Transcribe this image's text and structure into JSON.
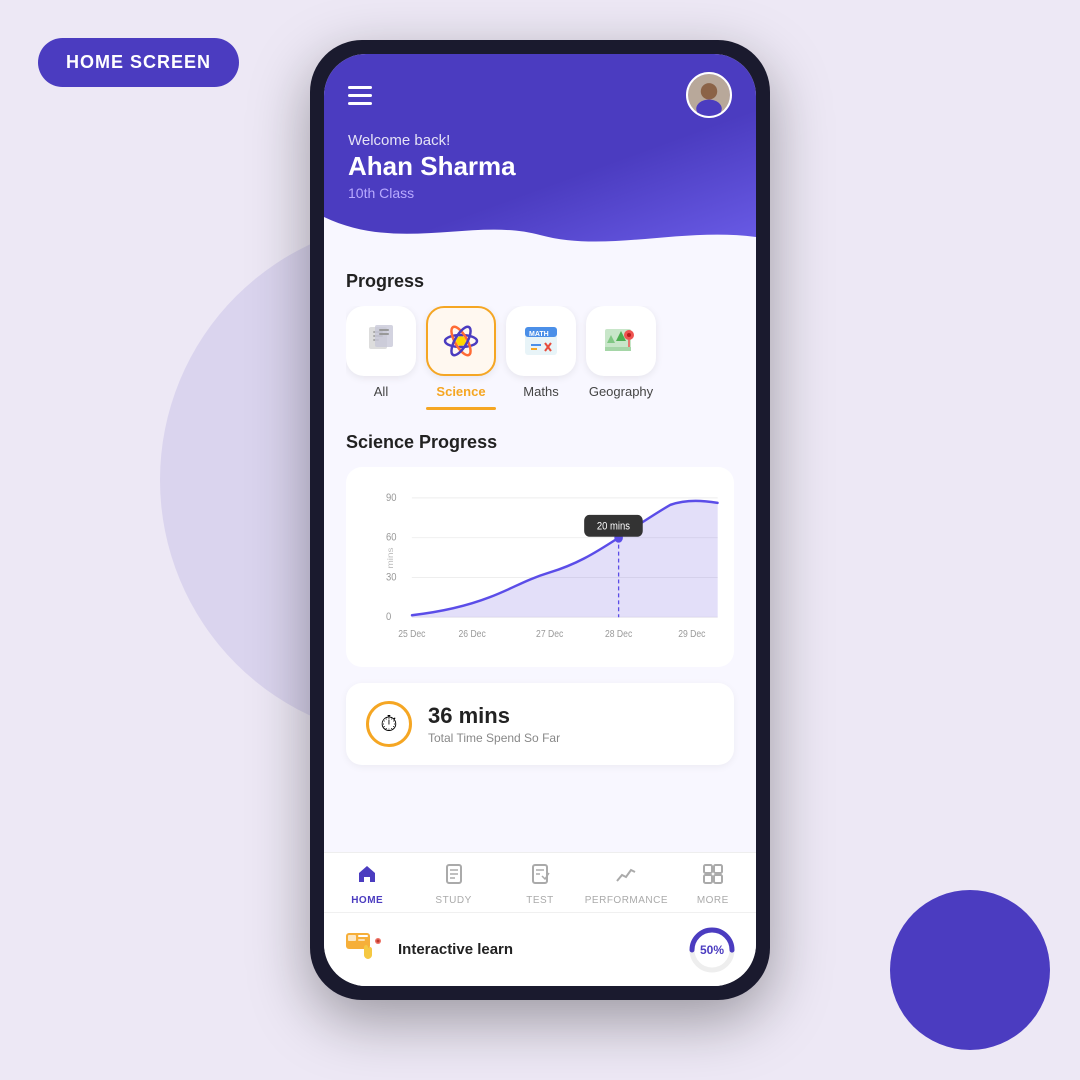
{
  "label": {
    "home_screen": "HOME SCREEN"
  },
  "header": {
    "welcome": "Welcome back!",
    "user_name": "Ahan Sharma",
    "user_class": "10th Class"
  },
  "progress_section": {
    "title": "Progress",
    "tabs": [
      {
        "id": "all",
        "label": "All",
        "icon": "📄",
        "active": false
      },
      {
        "id": "science",
        "label": "Science",
        "icon": "⚛️",
        "active": true
      },
      {
        "id": "maths",
        "label": "Maths",
        "icon": "📐",
        "active": false
      },
      {
        "id": "geography",
        "label": "Geography",
        "icon": "🗺️",
        "active": false
      }
    ]
  },
  "chart": {
    "title": "Science Progress",
    "y_label": "mins",
    "y_values": [
      "90",
      "60",
      "30",
      "0"
    ],
    "x_values": [
      "25 Dec",
      "26 Dec",
      "27 Dec",
      "28 Dec",
      "29 Dec"
    ],
    "tooltip": "20 mins",
    "tooltip_x": "28 Dec"
  },
  "stats": {
    "time": "36 mins",
    "label": "Total Time Spend So Far"
  },
  "nav": {
    "items": [
      {
        "id": "home",
        "label": "HOME",
        "icon": "🏠",
        "active": true
      },
      {
        "id": "study",
        "label": "STUDY",
        "icon": "📄",
        "active": false
      },
      {
        "id": "test",
        "label": "TEST",
        "icon": "📋",
        "active": false
      },
      {
        "id": "performance",
        "label": "PERFORMANCE",
        "icon": "📈",
        "active": false
      },
      {
        "id": "more",
        "label": "MORE",
        "icon": "⊞",
        "active": false
      }
    ]
  },
  "interactive": {
    "label": "Interactive learn",
    "percent": "50%",
    "percent_value": 50
  }
}
